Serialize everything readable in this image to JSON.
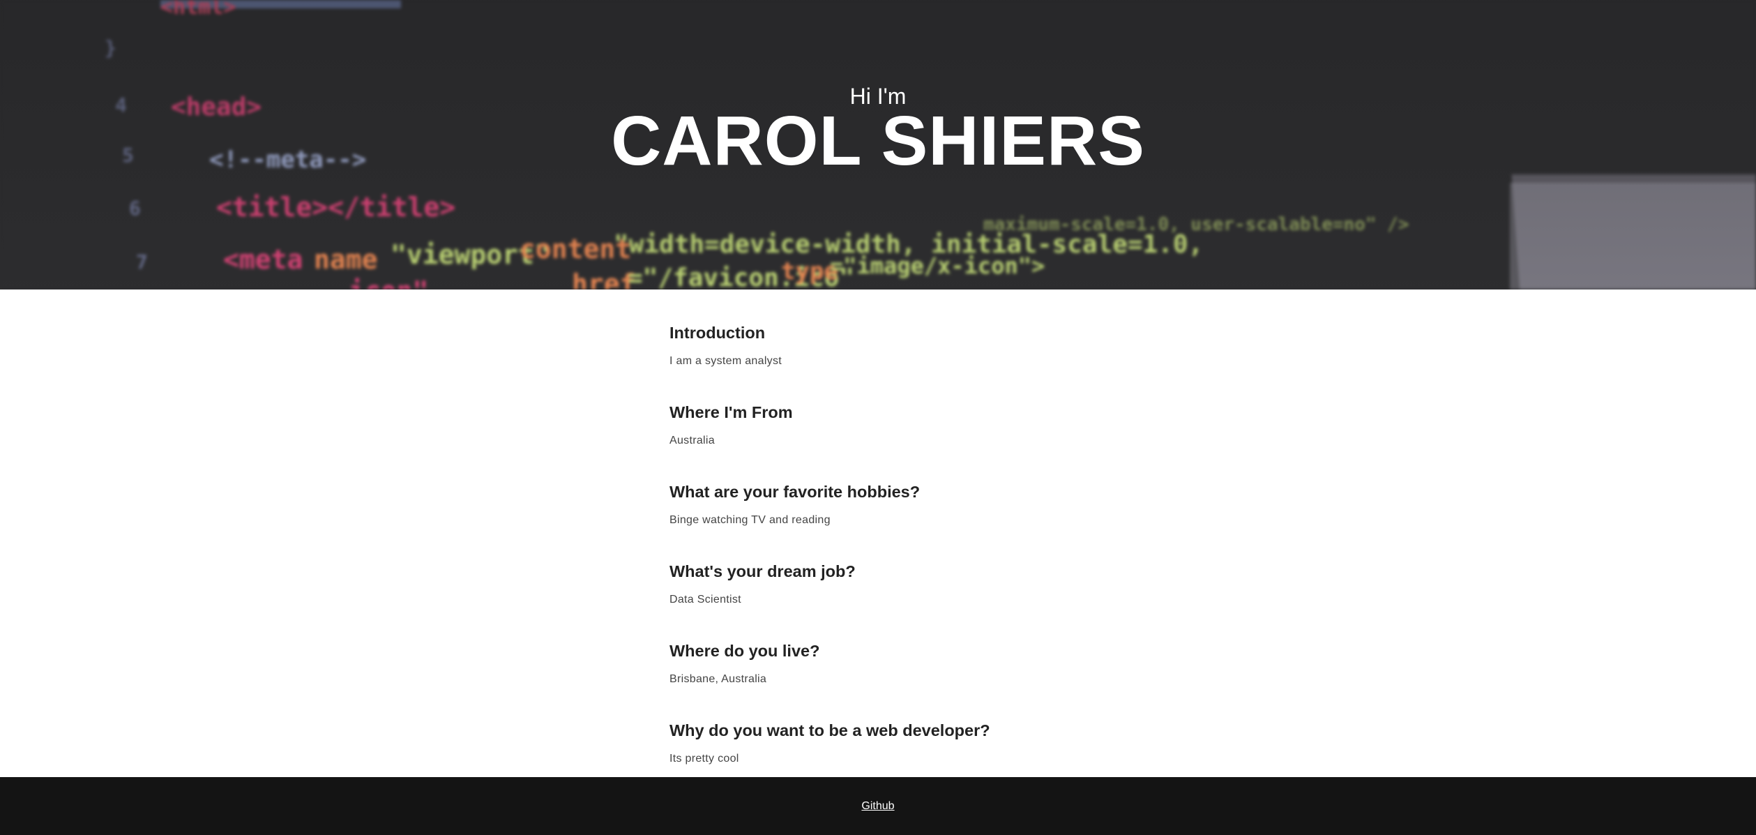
{
  "hero": {
    "greeting": "Hi I'm",
    "name": "CAROL SHIERS"
  },
  "sections": [
    {
      "title": "Introduction",
      "text": "I am a system analyst"
    },
    {
      "title": "Where I'm From",
      "text": "Australia"
    },
    {
      "title": "What are your favorite hobbies?",
      "text": "Binge watching TV and reading"
    },
    {
      "title": "What's your dream job?",
      "text": "Data Scientist"
    },
    {
      "title": "Where do you live?",
      "text": "Brisbane, Australia"
    },
    {
      "title": "Why do you want to be a web developer?",
      "text": "Its pretty cool"
    }
  ],
  "footer": {
    "link_label": "Github"
  },
  "colors": {
    "hero_bg": "#2e2e30",
    "footer_bg": "#141414",
    "heading": "#222222",
    "body_text": "#444444"
  }
}
